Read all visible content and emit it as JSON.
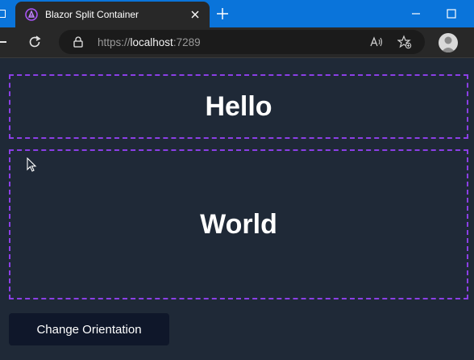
{
  "browser": {
    "tab_title": "Blazor Split Container",
    "url_scheme": "https://",
    "url_host": "localhost",
    "url_port": ":7289",
    "accent_color": "#0a74da"
  },
  "icons": {
    "favicon": "blazor-logo-icon",
    "tab_close": "close-icon",
    "new_tab": "plus-icon",
    "minimize": "minimize-icon",
    "maximize": "maximize-icon",
    "reload": "reload-icon",
    "lock": "lock-icon",
    "read_aloud": "read-aloud-icon",
    "favorites": "add-favorite-icon",
    "profile": "profile-avatar-icon",
    "cursor": "mouse-pointer-icon"
  },
  "page": {
    "background": "#1f2937",
    "pane_border_color": "#8b3fe6",
    "pane_top_text": "Hello",
    "pane_bottom_text": "World",
    "button_label": "Change Orientation"
  }
}
